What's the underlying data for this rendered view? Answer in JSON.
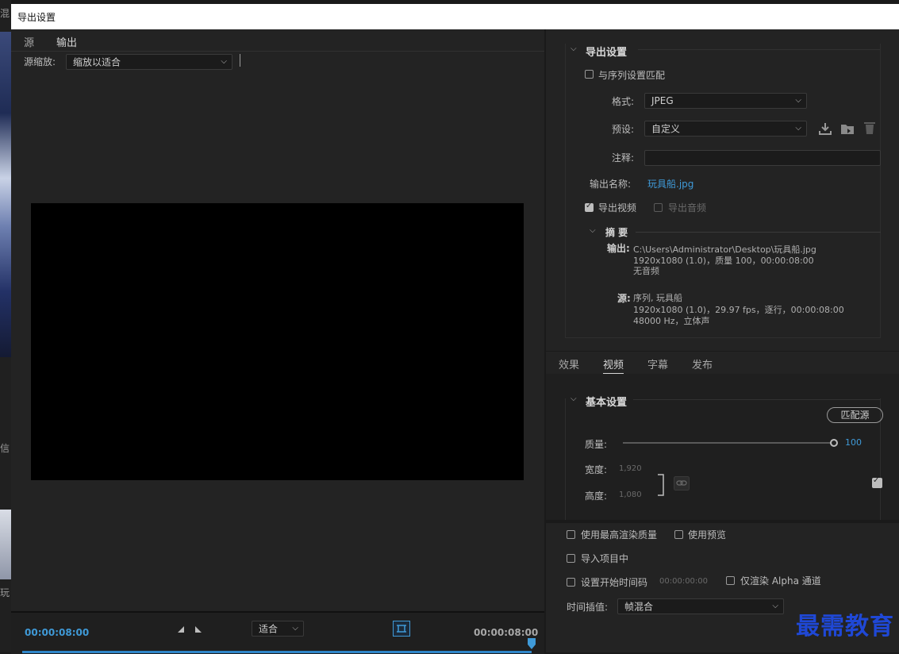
{
  "window": {
    "title": "导出设置"
  },
  "background": {
    "text_top": "混",
    "text_mid": "信",
    "text_bottom": "玩"
  },
  "left": {
    "tabs": [
      "源",
      "输出"
    ],
    "active_tab": "输出",
    "scale_label": "源缩放:",
    "scale_value": "缩放以适合",
    "timecode_start": "00:00:08:00",
    "timecode_end": "00:00:08:00",
    "fit_value": "适合"
  },
  "export_settings": {
    "header": "导出设置",
    "match_sequence": "与序列设置匹配",
    "format_label": "格式:",
    "format_value": "JPEG",
    "preset_label": "预设:",
    "preset_value": "自定义",
    "comment_label": "注释:",
    "comment_value": "",
    "output_name_label": "输出名称:",
    "output_name_value": "玩具船.jpg",
    "export_video": "导出视频",
    "export_audio": "导出音频",
    "export_video_checked": true,
    "export_audio_checked": false
  },
  "summary": {
    "header": "摘 要",
    "output_label": "输出:",
    "output_line1": "C:\\Users\\Administrator\\Desktop\\玩具船.jpg",
    "output_line2": "1920x1080 (1.0)，质量 100，00:00:08:00",
    "output_line3": "无音频",
    "source_label": "源:",
    "source_line1": "序列, 玩具船",
    "source_line2": "1920x1080 (1.0)，29.97 fps，逐行，00:00:08:00",
    "source_line3": "48000 Hz，立体声"
  },
  "right_tabs": [
    "效果",
    "视频",
    "字幕",
    "发布"
  ],
  "active_right_tab": "视频",
  "basic": {
    "header": "基本设置",
    "match_source": "匹配源",
    "quality_label": "质量:",
    "quality_value": "100",
    "quality_fraction": 1.0,
    "width_label": "宽度:",
    "width_value": "1,920",
    "height_label": "高度:",
    "height_value": "1,080"
  },
  "bottom_options": {
    "max_render": "使用最高渲染质量",
    "use_preview": "使用预览",
    "import_project": "导入项目中",
    "set_start_tc": "设置开始时间码",
    "start_tc_value": "00:00:00:00",
    "alpha_only": "仅渲染 Alpha 通道",
    "interp_label": "时间插值:",
    "interp_value": "帧混合"
  },
  "watermark": "最需教育",
  "colors": {
    "accent": "#3f9ad8",
    "watermark": "#1f48d6"
  }
}
